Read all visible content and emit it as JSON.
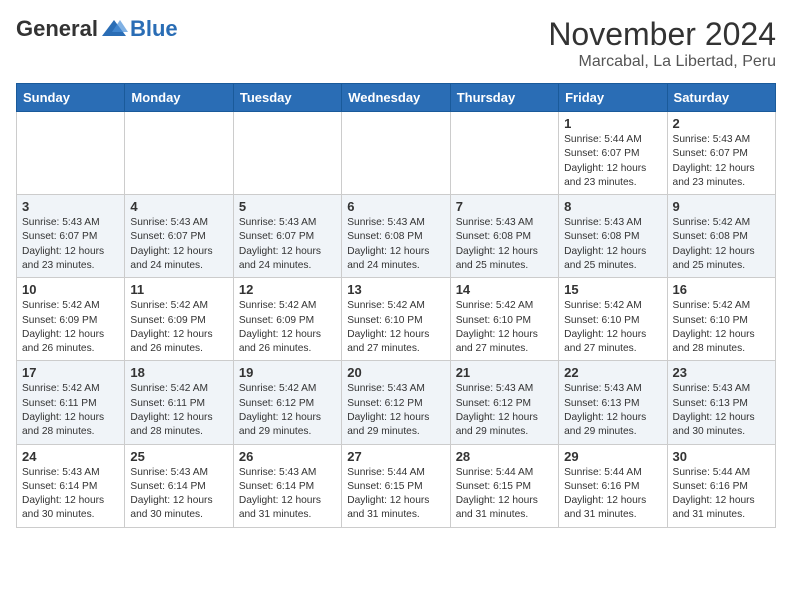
{
  "header": {
    "logo_general": "General",
    "logo_blue": "Blue",
    "month_title": "November 2024",
    "location": "Marcabal, La Libertad, Peru"
  },
  "days_of_week": [
    "Sunday",
    "Monday",
    "Tuesday",
    "Wednesday",
    "Thursday",
    "Friday",
    "Saturday"
  ],
  "weeks": [
    [
      {
        "day": "",
        "content": ""
      },
      {
        "day": "",
        "content": ""
      },
      {
        "day": "",
        "content": ""
      },
      {
        "day": "",
        "content": ""
      },
      {
        "day": "",
        "content": ""
      },
      {
        "day": "1",
        "content": "Sunrise: 5:44 AM\nSunset: 6:07 PM\nDaylight: 12 hours and 23 minutes."
      },
      {
        "day": "2",
        "content": "Sunrise: 5:43 AM\nSunset: 6:07 PM\nDaylight: 12 hours and 23 minutes."
      }
    ],
    [
      {
        "day": "3",
        "content": "Sunrise: 5:43 AM\nSunset: 6:07 PM\nDaylight: 12 hours and 23 minutes."
      },
      {
        "day": "4",
        "content": "Sunrise: 5:43 AM\nSunset: 6:07 PM\nDaylight: 12 hours and 24 minutes."
      },
      {
        "day": "5",
        "content": "Sunrise: 5:43 AM\nSunset: 6:07 PM\nDaylight: 12 hours and 24 minutes."
      },
      {
        "day": "6",
        "content": "Sunrise: 5:43 AM\nSunset: 6:08 PM\nDaylight: 12 hours and 24 minutes."
      },
      {
        "day": "7",
        "content": "Sunrise: 5:43 AM\nSunset: 6:08 PM\nDaylight: 12 hours and 25 minutes."
      },
      {
        "day": "8",
        "content": "Sunrise: 5:43 AM\nSunset: 6:08 PM\nDaylight: 12 hours and 25 minutes."
      },
      {
        "day": "9",
        "content": "Sunrise: 5:42 AM\nSunset: 6:08 PM\nDaylight: 12 hours and 25 minutes."
      }
    ],
    [
      {
        "day": "10",
        "content": "Sunrise: 5:42 AM\nSunset: 6:09 PM\nDaylight: 12 hours and 26 minutes."
      },
      {
        "day": "11",
        "content": "Sunrise: 5:42 AM\nSunset: 6:09 PM\nDaylight: 12 hours and 26 minutes."
      },
      {
        "day": "12",
        "content": "Sunrise: 5:42 AM\nSunset: 6:09 PM\nDaylight: 12 hours and 26 minutes."
      },
      {
        "day": "13",
        "content": "Sunrise: 5:42 AM\nSunset: 6:10 PM\nDaylight: 12 hours and 27 minutes."
      },
      {
        "day": "14",
        "content": "Sunrise: 5:42 AM\nSunset: 6:10 PM\nDaylight: 12 hours and 27 minutes."
      },
      {
        "day": "15",
        "content": "Sunrise: 5:42 AM\nSunset: 6:10 PM\nDaylight: 12 hours and 27 minutes."
      },
      {
        "day": "16",
        "content": "Sunrise: 5:42 AM\nSunset: 6:10 PM\nDaylight: 12 hours and 28 minutes."
      }
    ],
    [
      {
        "day": "17",
        "content": "Sunrise: 5:42 AM\nSunset: 6:11 PM\nDaylight: 12 hours and 28 minutes."
      },
      {
        "day": "18",
        "content": "Sunrise: 5:42 AM\nSunset: 6:11 PM\nDaylight: 12 hours and 28 minutes."
      },
      {
        "day": "19",
        "content": "Sunrise: 5:42 AM\nSunset: 6:12 PM\nDaylight: 12 hours and 29 minutes."
      },
      {
        "day": "20",
        "content": "Sunrise: 5:43 AM\nSunset: 6:12 PM\nDaylight: 12 hours and 29 minutes."
      },
      {
        "day": "21",
        "content": "Sunrise: 5:43 AM\nSunset: 6:12 PM\nDaylight: 12 hours and 29 minutes."
      },
      {
        "day": "22",
        "content": "Sunrise: 5:43 AM\nSunset: 6:13 PM\nDaylight: 12 hours and 29 minutes."
      },
      {
        "day": "23",
        "content": "Sunrise: 5:43 AM\nSunset: 6:13 PM\nDaylight: 12 hours and 30 minutes."
      }
    ],
    [
      {
        "day": "24",
        "content": "Sunrise: 5:43 AM\nSunset: 6:14 PM\nDaylight: 12 hours and 30 minutes."
      },
      {
        "day": "25",
        "content": "Sunrise: 5:43 AM\nSunset: 6:14 PM\nDaylight: 12 hours and 30 minutes."
      },
      {
        "day": "26",
        "content": "Sunrise: 5:43 AM\nSunset: 6:14 PM\nDaylight: 12 hours and 31 minutes."
      },
      {
        "day": "27",
        "content": "Sunrise: 5:44 AM\nSunset: 6:15 PM\nDaylight: 12 hours and 31 minutes."
      },
      {
        "day": "28",
        "content": "Sunrise: 5:44 AM\nSunset: 6:15 PM\nDaylight: 12 hours and 31 minutes."
      },
      {
        "day": "29",
        "content": "Sunrise: 5:44 AM\nSunset: 6:16 PM\nDaylight: 12 hours and 31 minutes."
      },
      {
        "day": "30",
        "content": "Sunrise: 5:44 AM\nSunset: 6:16 PM\nDaylight: 12 hours and 31 minutes."
      }
    ]
  ]
}
